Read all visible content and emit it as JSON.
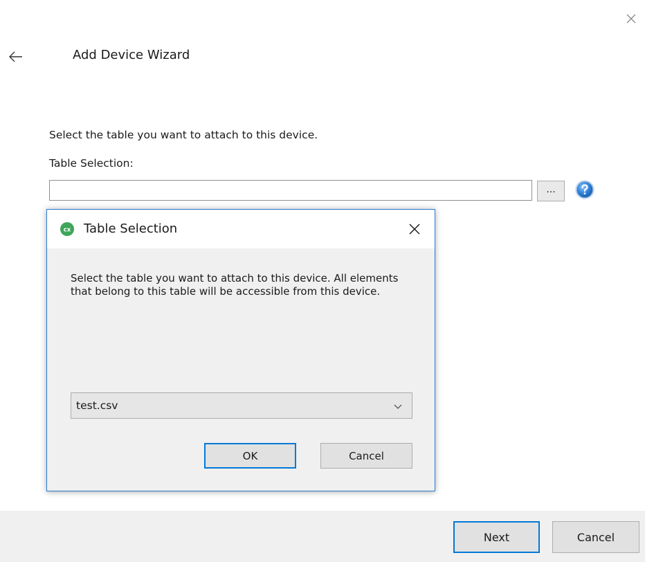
{
  "wizard": {
    "title": "Add Device Wizard",
    "instruction": "Select the table you want to attach to this device.",
    "field_label": "Table Selection:",
    "field_value": "",
    "browse_label": "..."
  },
  "footer": {
    "next_label": "Next",
    "cancel_label": "Cancel"
  },
  "dialog": {
    "title": "Table Selection",
    "message": "Select the table you want to attach to this device. All elements that belong to this table will be accessible from this device.",
    "selected_table": "test.csv",
    "ok_label": "OK",
    "cancel_label": "Cancel"
  },
  "icons": {
    "window_close": "close-icon",
    "back": "back-arrow-icon",
    "help": "help-icon",
    "app": "app-icon",
    "dialog_close": "close-icon",
    "dropdown": "chevron-down-icon"
  },
  "colors": {
    "accent": "#0078d7",
    "help_blue": "#1e6fc7",
    "app_green": "#3fa55a",
    "dialog_border": "#2b79cf",
    "footer_bg": "#f0f0f0"
  }
}
